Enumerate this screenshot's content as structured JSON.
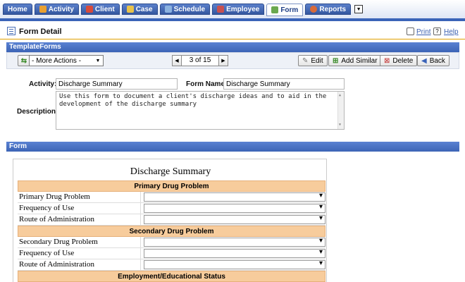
{
  "tabs": [
    {
      "label": "Home",
      "icon": "home",
      "active": false
    },
    {
      "label": "Activity",
      "icon": "activity-icon",
      "active": false
    },
    {
      "label": "Client",
      "icon": "client-icon",
      "active": false
    },
    {
      "label": "Case",
      "icon": "case-icon",
      "active": false
    },
    {
      "label": "Schedule",
      "icon": "schedule-icon",
      "active": false
    },
    {
      "label": "Employee",
      "icon": "employee-icon",
      "active": false
    },
    {
      "label": "Form",
      "icon": "form-icon",
      "active": true
    },
    {
      "label": "Reports",
      "icon": "reports-icon",
      "active": false
    }
  ],
  "header": {
    "title": "Form Detail",
    "print_label": "Print",
    "help_label": "Help"
  },
  "template_section": {
    "title": "TemplateForms"
  },
  "toolbar": {
    "actions_select": "- More Actions -",
    "pager_text": "3 of 15",
    "edit_label": "Edit",
    "add_similar_label": "Add Similar",
    "delete_label": "Delete",
    "back_label": "Back"
  },
  "fields": {
    "activity_label": "Activity:",
    "activity_value": "Discharge Summary",
    "form_name_label": "Form Name:",
    "form_name_value": "Discharge Summary",
    "description_label": "Description:",
    "description_value": "Use this form to document a client's discharge ideas and to aid in the development of the discharge summary"
  },
  "form_section": {
    "title": "Form"
  },
  "form": {
    "title": "Discharge Summary",
    "sections": [
      {
        "header": "Primary Drug Problem",
        "rows": [
          "Primary Drug Problem",
          "Frequency of Use",
          "Route of Administration"
        ]
      },
      {
        "header": "Secondary Drug Problem",
        "rows": [
          "Secondary Drug Problem",
          "Frequency of Use",
          "Route of Administration"
        ]
      },
      {
        "header": "Employment/Educational Status",
        "rows": []
      }
    ]
  },
  "colors": {
    "tab_blue": "#3a63b8",
    "section_header": "#f7cc9c",
    "bar_blue": "#4a72c4"
  }
}
